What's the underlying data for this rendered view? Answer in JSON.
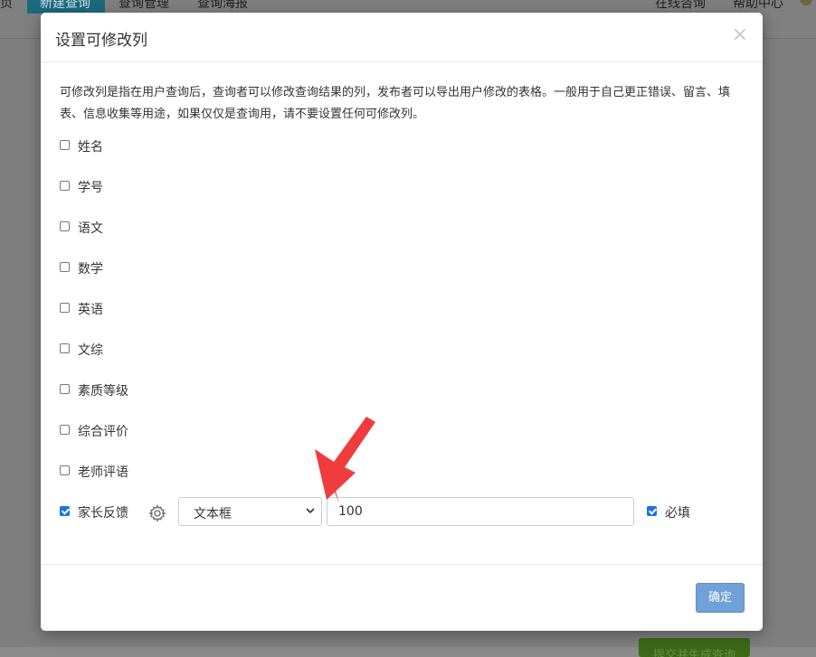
{
  "background": {
    "nav": {
      "item_home_fragment": "页",
      "item_new_query": "新建查询",
      "item_query_manage": "查询管理",
      "item_query_poster": "查询海报",
      "item_online_consult": "在线咨询",
      "item_help_center": "帮助中心"
    },
    "bottom_button_label": "提交并生成查询"
  },
  "modal": {
    "title": "设置可修改列",
    "close_icon": "close-icon",
    "description": "可修改列是指在用户查询后，查询者可以修改查询结果的列，发布者可以导出用户修改的表格。一般用于自己更正错误、留言、填表、信息收集等用途，如果仅仅是查询用，请不要设置任何可修改列。",
    "columns": [
      {
        "label": "姓名",
        "checked": false
      },
      {
        "label": "学号",
        "checked": false
      },
      {
        "label": "语文",
        "checked": false
      },
      {
        "label": "数学",
        "checked": false
      },
      {
        "label": "英语",
        "checked": false
      },
      {
        "label": "文综",
        "checked": false
      },
      {
        "label": "素质等级",
        "checked": false
      },
      {
        "label": "综合评价",
        "checked": false
      },
      {
        "label": "老师评语",
        "checked": false
      },
      {
        "label": "家长反馈",
        "checked": true
      }
    ],
    "settings_icon": "gear-icon",
    "field_type_selected": "文本框",
    "max_length_value": "100",
    "required_label": "必填",
    "required_checked": true,
    "ok_button_label": "确定"
  },
  "colors": {
    "primary_button": "#70a1d8",
    "checkbox_checked": "#1a73e8",
    "annotation_arrow": "#f03c3c",
    "overlay": "#7f7f7f"
  }
}
